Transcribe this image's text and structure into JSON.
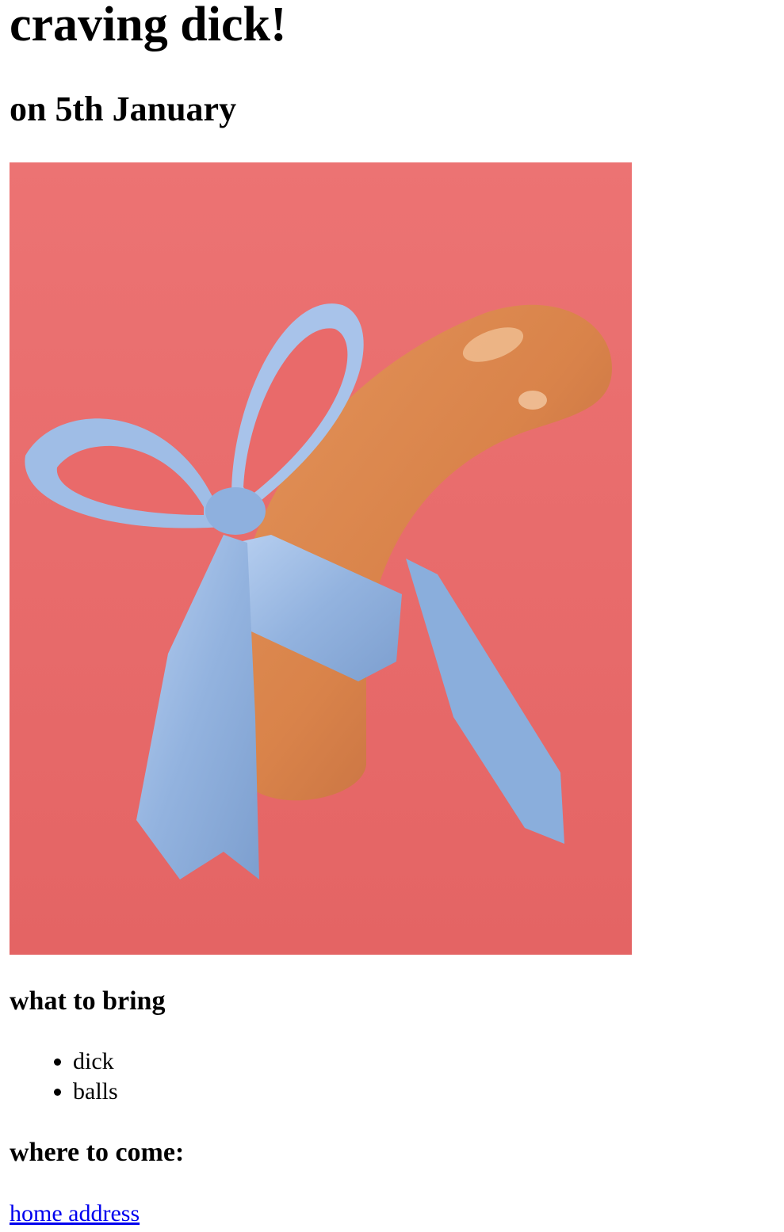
{
  "header": {
    "title": "craving dick!",
    "date": "on 5th January"
  },
  "image": {
    "description_icon": "sausage-with-ribbon-image",
    "background_color": "#e96a6a",
    "ribbon_color": "#9bbbe4",
    "sausage_color": "#d98a4f"
  },
  "bring": {
    "heading": "what to bring",
    "items": [
      "dick",
      "balls"
    ]
  },
  "come": {
    "heading": "where to come:",
    "link_label": "home address",
    "link_color": "#0000ee"
  }
}
